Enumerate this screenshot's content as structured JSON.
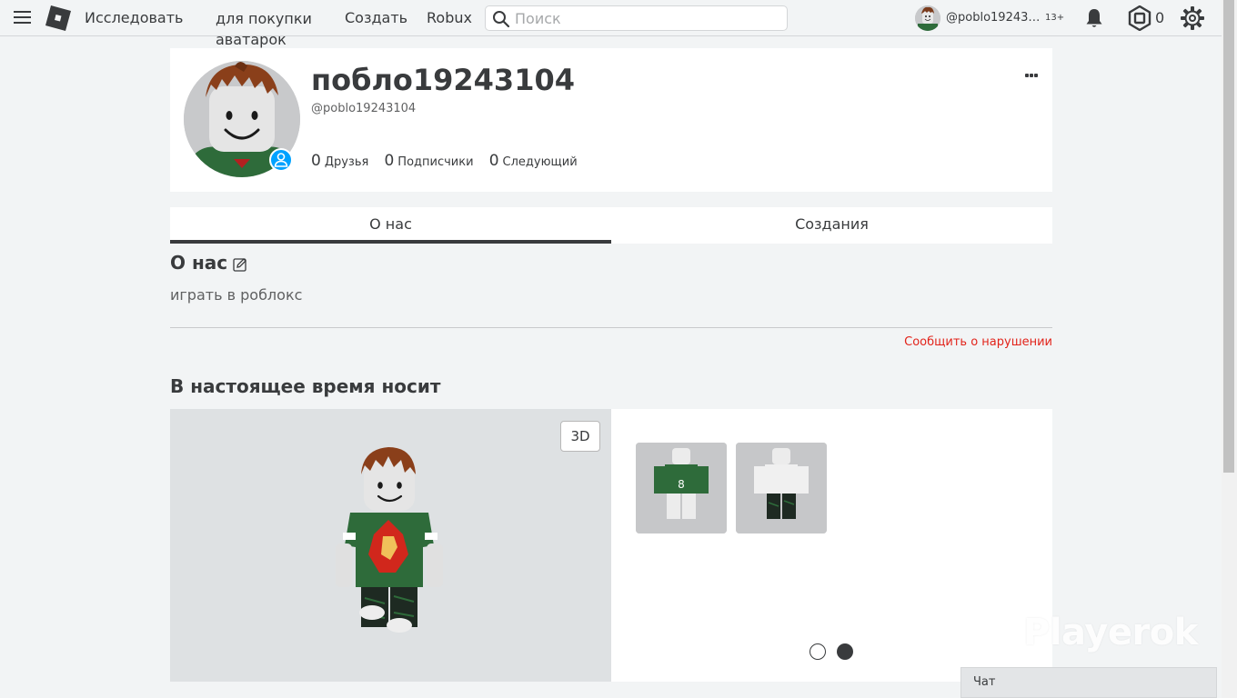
{
  "topbar": {
    "nav": {
      "explore": "Исследовать",
      "avatar_shop": "для покупки аватарок",
      "create": "Создать",
      "robux": "Robux"
    },
    "search_placeholder": "Поиск",
    "user": {
      "username": "@poblo192431...",
      "age_badge": "13+"
    },
    "robux_count": "0"
  },
  "profile": {
    "display_name": "поблo19243104",
    "username": "@poblo19243104",
    "stats": [
      {
        "count": "0",
        "label": "Друзья"
      },
      {
        "count": "0",
        "label": "Подписчики"
      },
      {
        "count": "0",
        "label": "Следующий"
      }
    ]
  },
  "tabs": {
    "about": "О нас",
    "creations": "Создания"
  },
  "about": {
    "title": "О нас",
    "description": "играть в роблокс",
    "report": "Сообщить о нарушении"
  },
  "wearing": {
    "title": "В настоящее время носит",
    "button_3d": "3D",
    "page_count": 2,
    "active_page": 2
  },
  "watermark": "Playerok",
  "chat": {
    "label": "Чат"
  },
  "colors": {
    "accent_blue": "#00a2ff",
    "report_red": "#e2231a",
    "text": "#393b3d",
    "background": "#f2f4f5"
  }
}
